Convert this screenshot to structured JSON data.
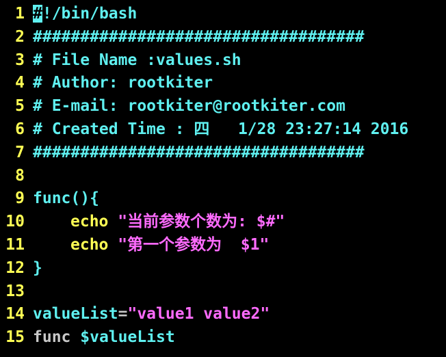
{
  "colors": {
    "background": "#000000",
    "line_number": "#ffff54",
    "comment": "#5ff0f0",
    "string": "#ff6bff",
    "keyword": "#5ff0f0",
    "plain": "#c9c9c9"
  },
  "lines": [
    {
      "num": "1",
      "cursor": "#",
      "text": "!/bin/bash"
    },
    {
      "num": "2",
      "text": "###################################"
    },
    {
      "num": "3",
      "text": "# File Name :values.sh"
    },
    {
      "num": "4",
      "text": "# Author: rootkiter"
    },
    {
      "num": "5",
      "text": "# E-mail: rootkiter@rootkiter.com"
    },
    {
      "num": "6",
      "text": "# Created Time : 四   1/28 23:27:14 2016"
    },
    {
      "num": "7",
      "text": "###################################"
    },
    {
      "num": "8",
      "text": ""
    },
    {
      "num": "9",
      "text": "func(){"
    },
    {
      "num": "10",
      "cmd": "echo",
      "str": "\"当前参数个数为: $#\""
    },
    {
      "num": "11",
      "cmd": "echo",
      "str": "\"第一个参数为  $1\""
    },
    {
      "num": "12",
      "text": "}"
    },
    {
      "num": "13",
      "text": ""
    },
    {
      "num": "14",
      "var": "valueList",
      "op": "=",
      "str": "\"value1 value2\""
    },
    {
      "num": "15",
      "plain": "func ",
      "var": "$valueList"
    }
  ]
}
